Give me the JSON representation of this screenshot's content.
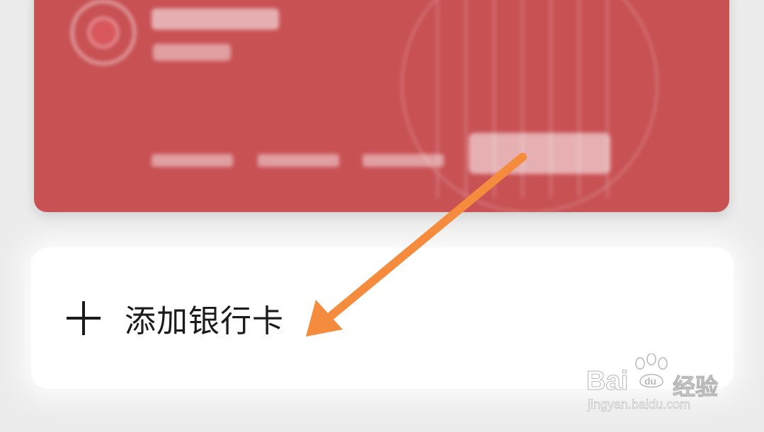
{
  "add_card": {
    "label": "添加银行卡",
    "icon": "plus-icon"
  },
  "card": {
    "color": "#c85154",
    "last_digits": ""
  },
  "annotation": {
    "arrow_color": "#f58b3c"
  },
  "watermark": {
    "brand": "Bai",
    "brand_suffix": "经验",
    "domain": "jingyan.baidu.com"
  }
}
